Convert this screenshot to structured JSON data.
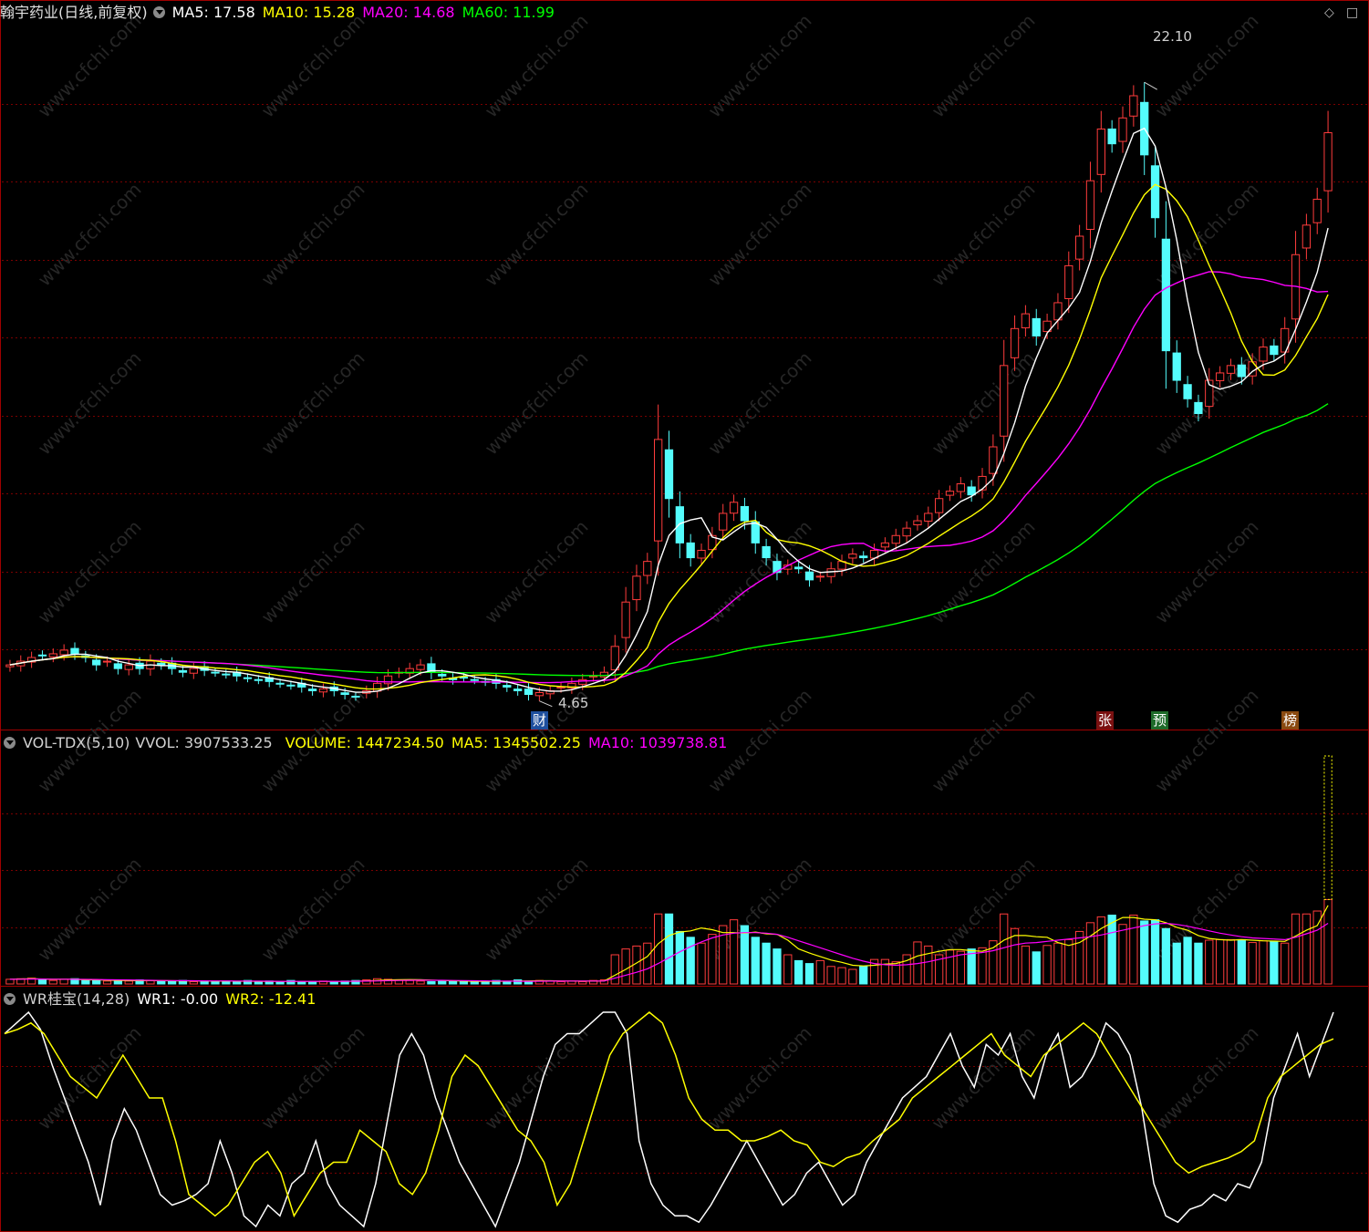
{
  "title": "翰宇药业(日线,前复权)",
  "ma_legend": [
    {
      "label": "MA5: 17.58",
      "color": "#ffffff"
    },
    {
      "label": "MA10: 15.28",
      "color": "#ffff00"
    },
    {
      "label": "MA20: 14.68",
      "color": "#ff00ff"
    },
    {
      "label": "MA60: 11.99",
      "color": "#00ff00"
    }
  ],
  "volume_legend": {
    "name": "VOL-TDX(5,10)",
    "vvol": "VVOL: 3907533.25",
    "volume": "VOLUME: 1447234.50",
    "ma5": "MA5: 1345502.25",
    "ma10": "MA10: 1039738.81"
  },
  "wr_legend": {
    "name": "WR桂宝(14,28)",
    "wr1": "WR1: -0.00",
    "wr2": "WR2: -12.41"
  },
  "annotations": {
    "high": "22.10",
    "low": "4.65",
    "badge_cai": "财",
    "badge_zhang": "张",
    "badge_yu": "预",
    "badge_bang": "榜"
  },
  "icons": {
    "diamond": "◇",
    "square": "□"
  },
  "watermark": "www.cfchi.com",
  "colors": {
    "up": "#ff3c3c",
    "down": "#54fcfc",
    "ma5": "#ffffff",
    "ma10": "#ffff00",
    "ma20": "#ff00ff",
    "ma60": "#00ff00",
    "grid": "#7a0000",
    "border": "#a00000"
  },
  "chart_data": [
    {
      "type": "candlestick",
      "ylim": [
        4.0,
        23.0
      ],
      "closes": [
        5.7,
        5.8,
        5.9,
        5.95,
        6.0,
        6.1,
        6.0,
        5.9,
        5.7,
        5.8,
        5.6,
        5.7,
        5.6,
        5.8,
        5.7,
        5.6,
        5.5,
        5.6,
        5.55,
        5.5,
        5.45,
        5.4,
        5.35,
        5.3,
        5.25,
        5.2,
        5.15,
        5.1,
        5.0,
        5.05,
        5.0,
        4.9,
        4.85,
        5.0,
        5.2,
        5.4,
        5.5,
        5.6,
        5.7,
        5.5,
        5.4,
        5.3,
        5.35,
        5.3,
        5.25,
        5.2,
        5.1,
        5.0,
        4.9,
        4.95,
        5.0,
        5.1,
        5.2,
        5.3,
        5.4,
        5.5,
        6.2,
        7.4,
        8.1,
        8.5,
        11.8,
        10.2,
        9.0,
        8.6,
        8.8,
        9.2,
        9.8,
        10.1,
        9.6,
        9.0,
        8.6,
        8.2,
        8.4,
        8.3,
        8.0,
        8.1,
        8.3,
        8.5,
        8.7,
        8.6,
        8.8,
        9.0,
        9.2,
        9.4,
        9.6,
        9.8,
        10.2,
        10.4,
        10.6,
        10.3,
        10.8,
        11.6,
        13.8,
        14.8,
        15.2,
        14.6,
        15.0,
        15.5,
        16.5,
        17.3,
        18.8,
        20.2,
        19.8,
        20.5,
        21.1,
        19.5,
        17.8,
        14.2,
        13.4,
        12.9,
        12.5,
        13.4,
        13.6,
        13.8,
        13.5,
        13.9,
        14.3,
        14.1,
        14.8,
        16.8,
        17.6,
        18.3,
        20.1
      ]
    },
    {
      "type": "bar",
      "series": [
        {
          "name": "VOLUME",
          "values": [
            80000,
            90000,
            100000,
            70000,
            60000,
            80000,
            90000,
            60000,
            70000,
            50000,
            60000,
            50000,
            70000,
            60000,
            50000,
            40000,
            60000,
            40000,
            50000,
            40000,
            50000,
            40000,
            60000,
            40000,
            50000,
            40000,
            60000,
            40000,
            40000,
            50000,
            40000,
            50000,
            60000,
            70000,
            90000,
            80000,
            70000,
            60000,
            50000,
            40000,
            50000,
            40000,
            40000,
            50000,
            40000,
            60000,
            40000,
            70000,
            50000,
            60000,
            50000,
            40000,
            50000,
            40000,
            60000,
            70000,
            500000,
            600000,
            650000,
            700000,
            1200000,
            1200000,
            900000,
            800000,
            700000,
            850000,
            1000000,
            1100000,
            1000000,
            800000,
            700000,
            600000,
            500000,
            400000,
            350000,
            400000,
            300000,
            280000,
            250000,
            300000,
            420000,
            420000,
            380000,
            500000,
            720000,
            650000,
            500000,
            580000,
            560000,
            600000,
            620000,
            740000,
            1200000,
            950000,
            650000,
            550000,
            660000,
            700000,
            760000,
            900000,
            1050000,
            1150000,
            1180000,
            1020000,
            1180000,
            1080000,
            1100000,
            950000,
            700000,
            800000,
            700000,
            750000,
            760000,
            760000,
            760000,
            710000,
            740000,
            730000,
            700000,
            1200000,
            1200000,
            1250000,
            1447234.5
          ]
        },
        {
          "name": "MA5",
          "values": [
            80000,
            85000,
            90000,
            85000,
            80000,
            80000,
            80000,
            70000,
            70000,
            65000,
            60000,
            58000,
            56000,
            58000,
            56000,
            54000,
            52000,
            52000,
            50000,
            48000,
            48000,
            47000,
            47000,
            46000,
            46000,
            45000,
            45000,
            45000,
            44000,
            44000,
            44000,
            45000,
            47000,
            51000,
            60000,
            68000,
            74000,
            75000,
            72000,
            66000,
            60000,
            55000,
            50000,
            46000,
            45000,
            46000,
            47000,
            50000,
            52000,
            54000,
            54000,
            52000,
            50000,
            48000,
            48000,
            50000,
            150000,
            250000,
            360000,
            470000,
            690000,
            830000,
            890000,
            910000,
            960000,
            930000,
            880000,
            880000,
            870000,
            890000,
            860000,
            850000,
            750000,
            600000,
            530000,
            470000,
            410000,
            370000,
            320000,
            310000,
            320000,
            340000,
            350000,
            400000,
            480000,
            520000,
            560000,
            590000,
            590000,
            570000,
            560000,
            620000,
            750000,
            830000,
            830000,
            810000,
            800000,
            710000,
            660000,
            710000,
            820000,
            950000,
            1050000,
            1140000,
            1140000,
            1110000,
            1100000,
            1050000,
            970000,
            920000,
            830000,
            780000,
            760000,
            750000,
            760000,
            750000,
            740000,
            735000,
            730000,
            820000,
            920000,
            1000000,
            1345502.25
          ]
        },
        {
          "name": "MA10",
          "values": [
            80000,
            82000,
            85000,
            84000,
            82000,
            81000,
            80000,
            78000,
            76000,
            72000,
            70000,
            68000,
            64000,
            62000,
            60000,
            58000,
            56000,
            55000,
            53000,
            52000,
            51000,
            50000,
            49000,
            48000,
            47000,
            46000,
            45000,
            45000,
            45000,
            45000,
            45000,
            46000,
            47000,
            49000,
            52000,
            56000,
            60000,
            63000,
            65000,
            63000,
            62000,
            60000,
            58000,
            55000,
            53000,
            50000,
            48000,
            47000,
            46000,
            47000,
            48000,
            49000,
            50000,
            50000,
            50000,
            50000,
            100000,
            150000,
            200000,
            260000,
            350000,
            450000,
            550000,
            640000,
            720000,
            790000,
            840000,
            870000,
            880000,
            880000,
            870000,
            850000,
            800000,
            740000,
            680000,
            620000,
            560000,
            500000,
            440000,
            390000,
            350000,
            330000,
            320000,
            330000,
            350000,
            380000,
            420000,
            460000,
            500000,
            520000,
            540000,
            570000,
            620000,
            670000,
            700000,
            710000,
            730000,
            750000,
            770000,
            790000,
            810000,
            840000,
            880000,
            920000,
            960000,
            1000000,
            1030000,
            1040000,
            1020000,
            990000,
            950000,
            910000,
            870000,
            840000,
            810000,
            790000,
            780000,
            770000,
            760000,
            800000,
            860000,
            920000,
            1039738.81
          ]
        }
      ],
      "ylim": [
        0,
        3907533.25
      ]
    },
    {
      "type": "line",
      "ylim": [
        -100,
        0
      ],
      "series": [
        {
          "name": "WR1",
          "values": [
            -10,
            -5,
            0,
            -8,
            -25,
            -40,
            -55,
            -70,
            -90,
            -60,
            -45,
            -55,
            -70,
            -85,
            -90,
            -88,
            -85,
            -80,
            -60,
            -75,
            -95,
            -100,
            -90,
            -95,
            -80,
            -75,
            -60,
            -80,
            -90,
            -95,
            -100,
            -80,
            -50,
            -20,
            -10,
            -20,
            -40,
            -55,
            -70,
            -80,
            -90,
            -100,
            -85,
            -70,
            -50,
            -30,
            -15,
            -10,
            -10,
            -5,
            0,
            0,
            -10,
            -60,
            -80,
            -90,
            -95,
            -95,
            -98,
            -90,
            -80,
            -70,
            -60,
            -70,
            -80,
            -90,
            -85,
            -75,
            -70,
            -80,
            -90,
            -85,
            -70,
            -60,
            -50,
            -40,
            -35,
            -30,
            -20,
            -10,
            -25,
            -35,
            -15,
            -20,
            -10,
            -30,
            -40,
            -20,
            -10,
            -35,
            -30,
            -20,
            -5,
            -10,
            -20,
            -45,
            -80,
            -95,
            -98,
            -92,
            -90,
            -85,
            -88,
            -80,
            -82,
            -70,
            -40,
            -25,
            -10,
            -30,
            -15,
            0
          ]
        },
        {
          "name": "WR2",
          "values": [
            -10,
            -8,
            -5,
            -10,
            -20,
            -30,
            -35,
            -40,
            -30,
            -20,
            -30,
            -40,
            -40,
            -60,
            -85,
            -90,
            -95,
            -90,
            -80,
            -70,
            -65,
            -75,
            -95,
            -85,
            -75,
            -70,
            -70,
            -55,
            -60,
            -65,
            -80,
            -85,
            -75,
            -55,
            -30,
            -20,
            -25,
            -35,
            -45,
            -55,
            -60,
            -70,
            -90,
            -80,
            -60,
            -40,
            -20,
            -10,
            -5,
            0,
            -5,
            -20,
            -40,
            -50,
            -55,
            -55,
            -60,
            -60,
            -58,
            -55,
            -60,
            -62,
            -70,
            -72,
            -68,
            -66,
            -60,
            -55,
            -50,
            -40,
            -35,
            -30,
            -25,
            -20,
            -15,
            -10,
            -20,
            -25,
            -30,
            -20,
            -15,
            -10,
            -5,
            -10,
            -20,
            -30,
            -40,
            -50,
            -60,
            -70,
            -75,
            -72,
            -70,
            -68,
            -65,
            -60,
            -40,
            -30,
            -25,
            -20,
            -15,
            -12.41
          ]
        }
      ]
    }
  ]
}
